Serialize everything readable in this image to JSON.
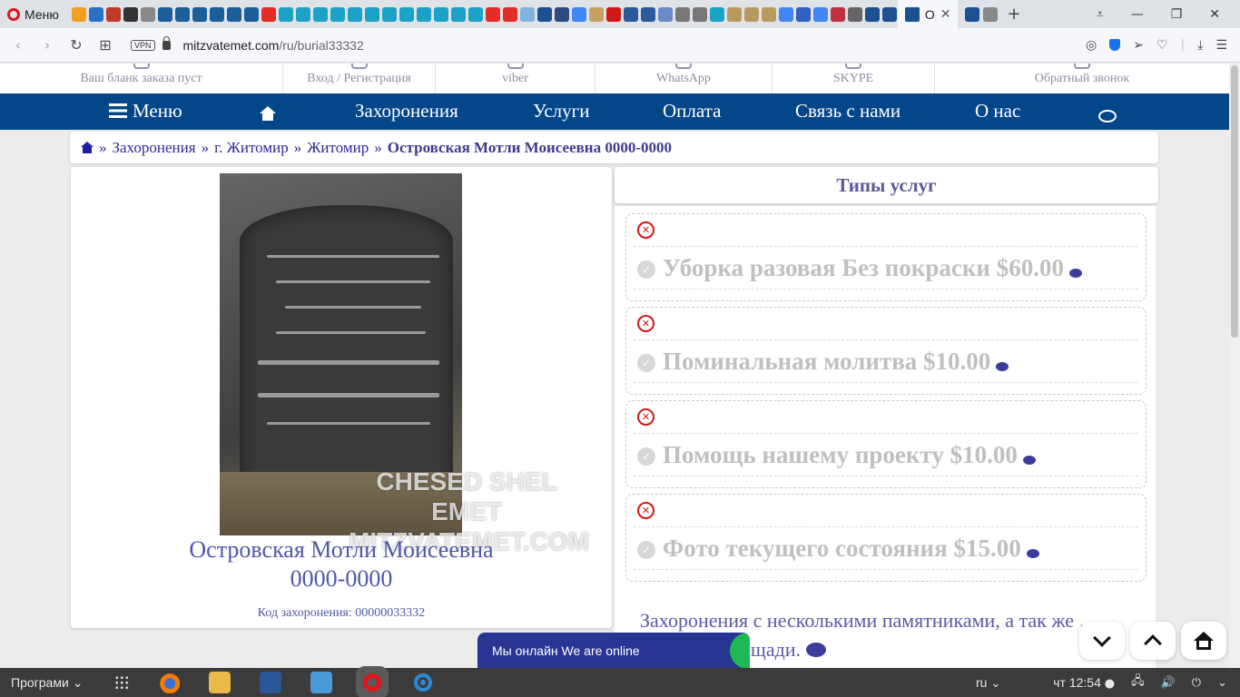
{
  "browser": {
    "menu_label": "Меню",
    "active_tab_title": "О",
    "url_domain": "mitzvatemet.com",
    "url_path": "/ru/burial33332",
    "vpn_label": "VPN"
  },
  "top_info": {
    "order_form": "Ваш бланк заказа пуст",
    "login": "Вход / Регистрация",
    "viber": "viber",
    "whatsapp": "WhatsApp",
    "skype": "SKYPE",
    "callback": "Обратный звонок"
  },
  "nav": {
    "menu": "Меню",
    "burials": "Захоронения",
    "services": "Услуги",
    "payment": "Оплата",
    "contact": "Связь с нами",
    "about": "О нас"
  },
  "breadcrumb": {
    "sep": "»",
    "items": [
      "Захоронения",
      "г. Житомир",
      "Житомир"
    ],
    "current": "Островская Мотли Моисеевна 0000-0000"
  },
  "burial": {
    "name": "Островская Мотли Моисеевна",
    "dates": "0000-0000",
    "code_label": "Код захоронения: 00000033332",
    "watermark_line1": "CHESED SHEL EMET",
    "watermark_line2": "MITZVATEMET.COM"
  },
  "services": {
    "title": "Типы услуг",
    "items": [
      {
        "label": "Уборка разовая Без покраски $60.00"
      },
      {
        "label": "Поминальная молитва $10.00"
      },
      {
        "label": "Помощь нашему проекту $10.00"
      },
      {
        "label": "Фото текущего состояния $15.00"
      }
    ]
  },
  "multi_text": "Захоронения с несколькими памятниками, а так же … большой площади.",
  "online_chat": "Мы онлайн We are online",
  "taskbar": {
    "start": "Програми",
    "lang": "ru",
    "clock": "чт 12:54"
  },
  "colors": {
    "nav_bg": "#03468a",
    "link": "#2c2c9a",
    "service_text": "#c0c0c0",
    "cancel_icon": "#d01818"
  }
}
